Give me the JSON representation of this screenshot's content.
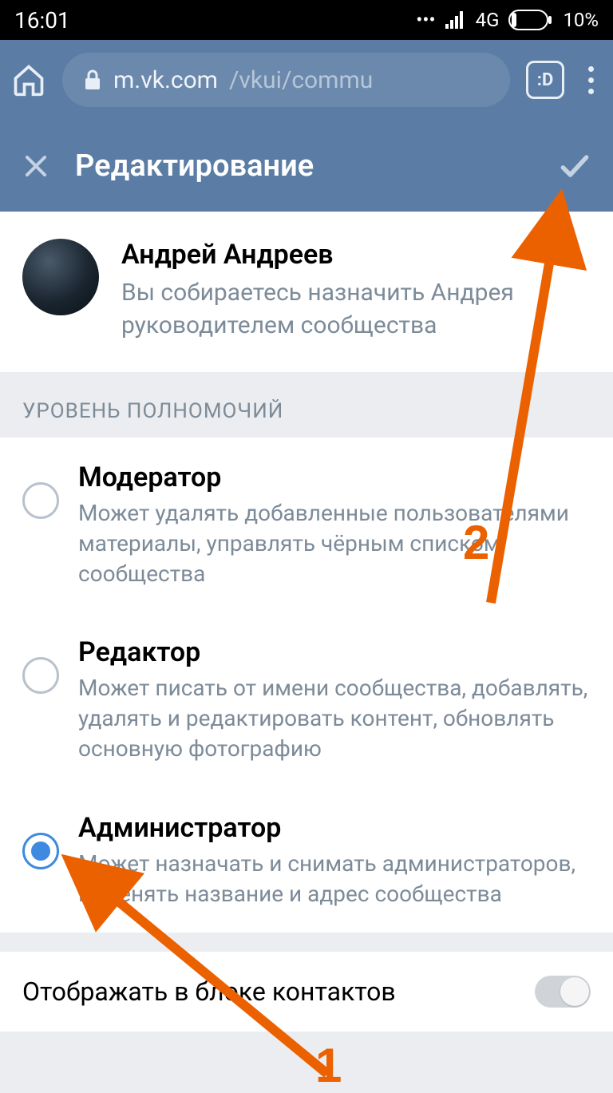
{
  "status": {
    "time": "16:01",
    "network": "4G",
    "battery": "10%"
  },
  "browser": {
    "domain": "m.vk.com",
    "path": "/vkui/commu",
    "tabs_glyph": ":D"
  },
  "header": {
    "title": "Редактирование"
  },
  "user": {
    "name": "Андрей Андреев",
    "description": "Вы собираетесь назначить Андрея руководителем сообщества"
  },
  "permissions": {
    "section_title": "УРОВЕНЬ ПОЛНОМОЧИЙ",
    "options": [
      {
        "title": "Модератор",
        "description": "Может удалять добавленные пользователями материалы, управлять чёрным списком сообщества",
        "selected": false
      },
      {
        "title": "Редактор",
        "description": "Может писать от имени сообщества, добавлять, удалять и редактировать контент, обновлять основную фотографию",
        "selected": false
      },
      {
        "title": "Администратор",
        "description": "Может назначать и снимать администраторов, изменять название и адрес сообщества",
        "selected": true
      }
    ]
  },
  "toggle": {
    "label": "Отображать в блоке контактов",
    "value": false
  },
  "annotations": {
    "one": "1",
    "two": "2"
  }
}
